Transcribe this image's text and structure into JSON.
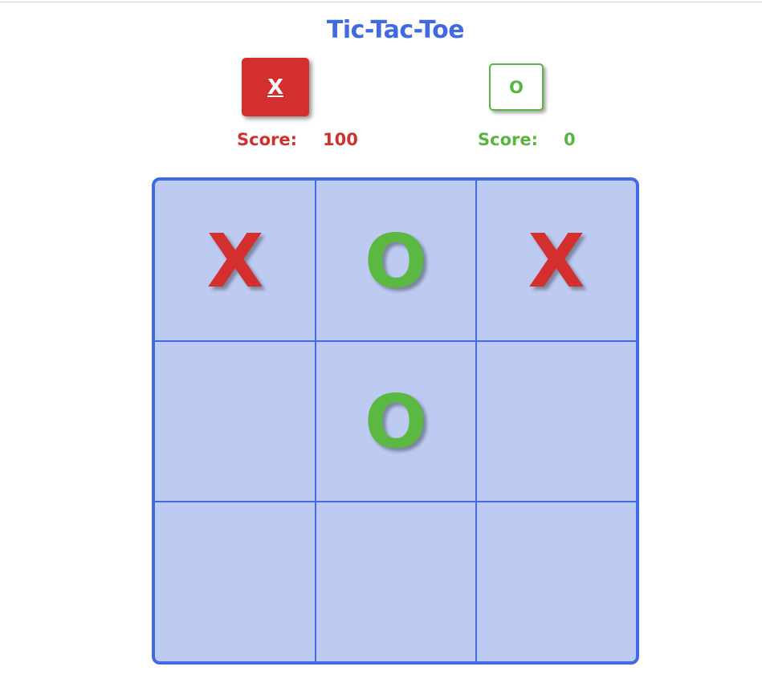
{
  "title": "Tic-Tac-Toe",
  "players": {
    "x": {
      "label": "X",
      "score_label": "Score:",
      "score": "100"
    },
    "o": {
      "label": "O",
      "score_label": "Score:",
      "score": "0"
    }
  },
  "board": {
    "cells": [
      "X",
      "O",
      "X",
      "",
      "O",
      "",
      "",
      "",
      ""
    ]
  },
  "colors": {
    "accent": "#4169e1",
    "board_fill": "#bdcbf2",
    "x_color": "#d32f2f",
    "o_color": "#58b640"
  }
}
